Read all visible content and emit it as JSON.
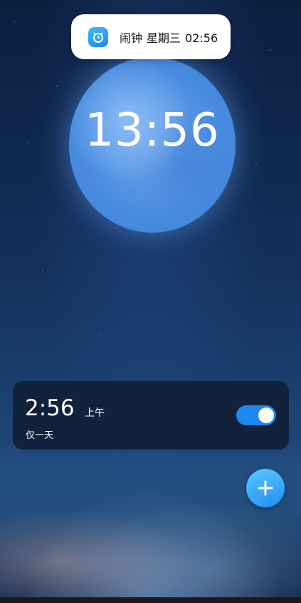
{
  "notification": {
    "app": "闹钟",
    "day": "星期三",
    "time": "02:56"
  },
  "clock": {
    "time": "13:56"
  },
  "alarm": {
    "time": "2:56",
    "ampm": "上午",
    "repeat": "仅一天",
    "enabled": true
  },
  "colors": {
    "accent": "#1e88f0",
    "card": "#102038",
    "fab": "#1f8ef0"
  },
  "icons": {
    "notification": "alarm-clock-icon",
    "fab": "plus-icon"
  }
}
